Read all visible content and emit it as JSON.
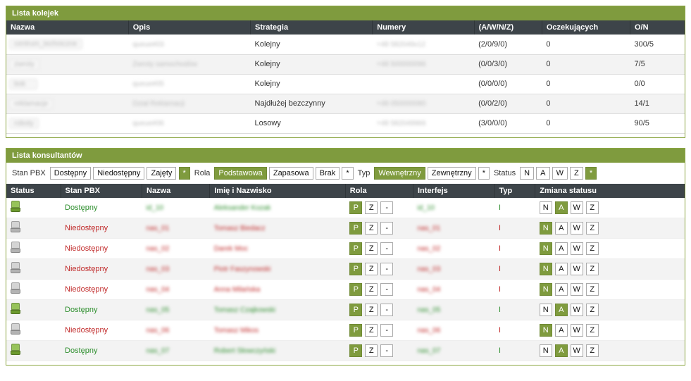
{
  "queues": {
    "title": "Lista kolejek",
    "headers": [
      "Nazwa",
      "Opis",
      "Strategia",
      "Numery",
      "(A/W/N/Z)",
      "Oczekujących",
      "O/N"
    ],
    "rows": [
      {
        "nazwa": "centrum_techniczne",
        "opis": "queue#03",
        "strategia": "Kolejny",
        "numery": "+48 582049x12",
        "awnz": "(2/0/9/0)",
        "oczek": "0",
        "on": "300/5"
      },
      {
        "nazwa": "zwroty",
        "opis": "Zwroty samochodów",
        "strategia": "Kolejny",
        "numery": "+48 500000096",
        "awnz": "(0/0/3/0)",
        "oczek": "0",
        "on": "7/5"
      },
      {
        "nazwa": "bok",
        "opis": "queue#05",
        "strategia": "Kolejny",
        "numery": "",
        "awnz": "(0/0/0/0)",
        "oczek": "0",
        "on": "0/0"
      },
      {
        "nazwa": "reklamacje",
        "opis": "Dział Reklamacji",
        "strategia": "Najdłużej bezczynny",
        "numery": "+48 050000080",
        "awnz": "(0/0/2/0)",
        "oczek": "0",
        "on": "14/1"
      },
      {
        "nazwa": "roboty",
        "opis": "queue#06",
        "strategia": "Losowy",
        "numery": "+48 582049966",
        "awnz": "(3/0/0/0)",
        "oczek": "0",
        "on": "90/5"
      }
    ]
  },
  "consultants": {
    "title": "Lista konsultantów",
    "filters": {
      "stan_pbx_label": "Stan PBX",
      "stan_pbx": [
        "Dostępny",
        "Niedostępny",
        "Zajęty",
        "*"
      ],
      "stan_pbx_selected": 3,
      "rola_label": "Rola",
      "rola": [
        "Podstawowa",
        "Zapasowa",
        "Brak",
        "*"
      ],
      "rola_selected": 0,
      "typ_label": "Typ",
      "typ": [
        "Wewnętrzny",
        "Zewnętrzny",
        "*"
      ],
      "typ_selected": 0,
      "status_label": "Status",
      "status": [
        "N",
        "A",
        "W",
        "Z",
        "*"
      ],
      "status_selected": 4
    },
    "headers": [
      "Status",
      "Stan PBX",
      "Nazwa",
      "Imię i Nazwisko",
      "Rola",
      "Interfejs",
      "Typ",
      "Zmiana statusu"
    ],
    "role_buttons": [
      "P",
      "Z",
      "-"
    ],
    "status_buttons": [
      "N",
      "A",
      "W",
      "Z"
    ],
    "rows": [
      {
        "icon": "green",
        "stan": "Dostępny",
        "stan_color": "green",
        "nazwa": "id_10",
        "imie": "Aleksander Kozak",
        "rola_sel": 0,
        "interfejs": "id_10",
        "typ": "I",
        "typ_color": "green",
        "status_sel": 1
      },
      {
        "icon": "grey",
        "stan": "Niedostępny",
        "stan_color": "red",
        "nazwa": "nas_01",
        "imie": "Tomasz Biedacz",
        "rola_sel": 0,
        "interfejs": "nas_01",
        "typ": "I",
        "typ_color": "red",
        "status_sel": 0
      },
      {
        "icon": "grey",
        "stan": "Niedostępny",
        "stan_color": "red",
        "nazwa": "nas_02",
        "imie": "Darek Moc",
        "rola_sel": 0,
        "interfejs": "nas_02",
        "typ": "I",
        "typ_color": "red",
        "status_sel": 0
      },
      {
        "icon": "grey",
        "stan": "Niedostępny",
        "stan_color": "red",
        "nazwa": "nas_03",
        "imie": "Piotr Faszynowski",
        "rola_sel": 0,
        "interfejs": "nas_03",
        "typ": "I",
        "typ_color": "red",
        "status_sel": 0
      },
      {
        "icon": "grey",
        "stan": "Niedostępny",
        "stan_color": "red",
        "nazwa": "nas_04",
        "imie": "Anna Milańska",
        "rola_sel": 0,
        "interfejs": "nas_04",
        "typ": "I",
        "typ_color": "red",
        "status_sel": 0
      },
      {
        "icon": "green",
        "stan": "Dostępny",
        "stan_color": "green",
        "nazwa": "nas_05",
        "imie": "Tomasz Czajkowski",
        "rola_sel": 0,
        "interfejs": "nas_05",
        "typ": "I",
        "typ_color": "green",
        "status_sel": 1
      },
      {
        "icon": "grey",
        "stan": "Niedostępny",
        "stan_color": "red",
        "nazwa": "nas_06",
        "imie": "Tomasz Mikos",
        "rola_sel": 0,
        "interfejs": "nas_06",
        "typ": "I",
        "typ_color": "red",
        "status_sel": 0
      },
      {
        "icon": "green",
        "stan": "Dostępny",
        "stan_color": "green",
        "nazwa": "nas_07",
        "imie": "Robert Słowczyński",
        "rola_sel": 0,
        "interfejs": "nas_07",
        "typ": "I",
        "typ_color": "green",
        "status_sel": 1
      }
    ]
  }
}
